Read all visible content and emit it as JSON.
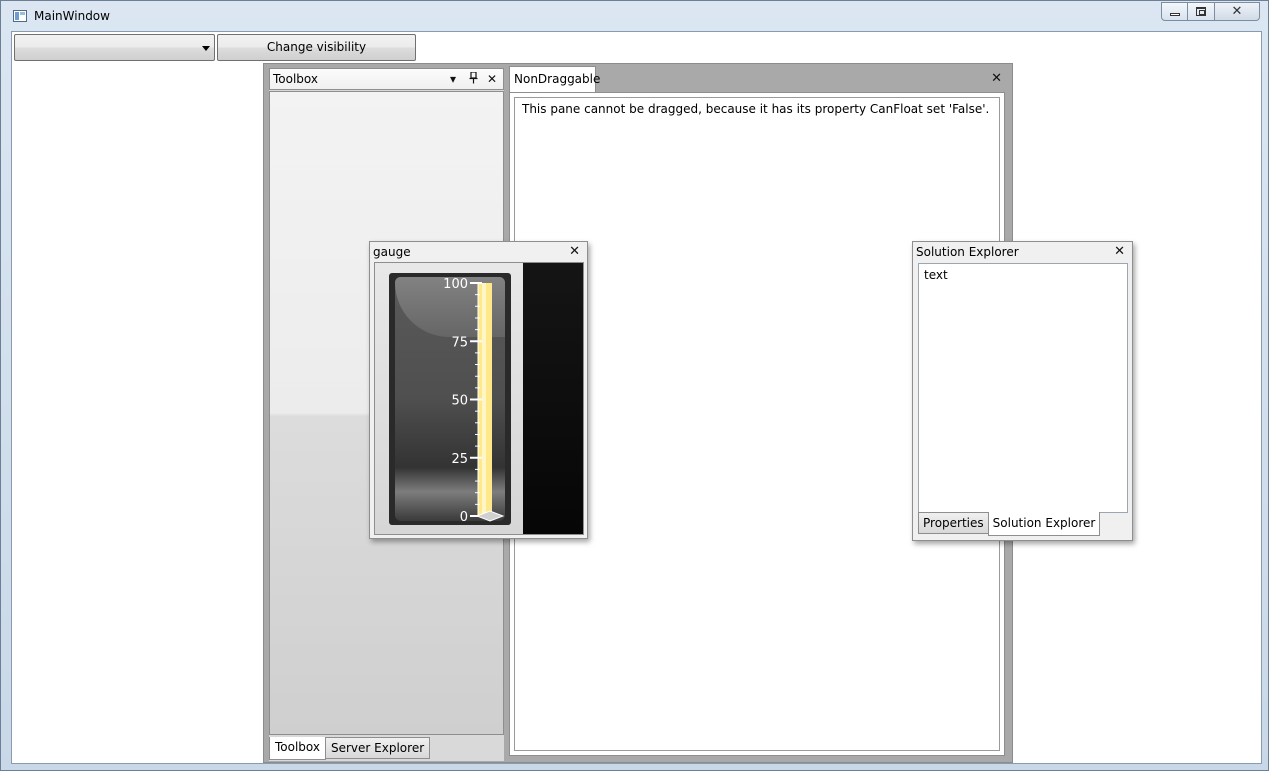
{
  "window": {
    "title": "MainWindow"
  },
  "toolbar": {
    "combo_value": "",
    "visibility_button": "Change visibility"
  },
  "toolbox": {
    "title": "Toolbox",
    "icons": [
      "dropdown-icon",
      "pin-icon",
      "close-icon"
    ],
    "tabs": [
      {
        "label": "Toolbox",
        "active": true
      },
      {
        "label": "Server Explorer",
        "active": false
      }
    ]
  },
  "non_draggable": {
    "tab_label": "NonDraggable",
    "message": "This pane cannot be dragged, because it has its property CanFloat set 'False'."
  },
  "gauge_window": {
    "title": "gauge",
    "scale": {
      "min": 0,
      "max": 100,
      "major_ticks": [
        0,
        25,
        50,
        75,
        100
      ],
      "labels": [
        "0",
        "25",
        "50",
        "75",
        "100"
      ],
      "value": 100,
      "bar_color": "#ffe88a"
    }
  },
  "solution_explorer": {
    "title": "Solution Explorer",
    "content": "text",
    "tabs": [
      {
        "label": "Properties",
        "active": false
      },
      {
        "label": "Solution Explorer",
        "active": true
      }
    ]
  }
}
